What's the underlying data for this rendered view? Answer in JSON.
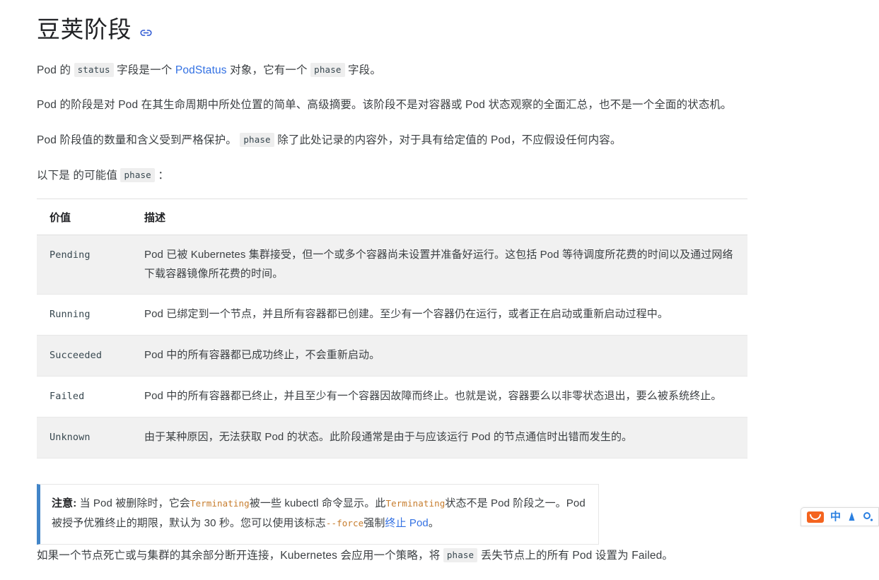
{
  "heading": {
    "title": "豆荚阶段",
    "anchor_icon": "link-icon"
  },
  "paragraphs": {
    "p1_a": "Pod 的 ",
    "p1_code1": "status",
    "p1_b": " 字段是一个 ",
    "p1_link": "PodStatus",
    "p1_c": " 对象，它有一个 ",
    "p1_code2": "phase",
    "p1_d": " 字段。",
    "p2": "Pod 的阶段是对 Pod 在其生命周期中所处位置的简单、高级摘要。该阶段不是对容器或 Pod 状态观察的全面汇总，也不是一个全面的状态机。",
    "p3_a": "Pod 阶段值的数量和含义受到严格保护。 ",
    "p3_code": "phase",
    "p3_b": " 除了此处记录的内容外，对于具有给定值的 Pod，不应假设任何内容。",
    "p4_a": "以下是 的可能值 ",
    "p4_code": "phase",
    "p4_b": " ："
  },
  "table": {
    "headers": [
      "价值",
      "描述"
    ],
    "rows": [
      {
        "value": "Pending",
        "description": "Pod 已被 Kubernetes 集群接受，但一个或多个容器尚未设置并准备好运行。这包括 Pod 等待调度所花费的时间以及通过网络下载容器镜像所花费的时间。"
      },
      {
        "value": "Running",
        "description": "Pod 已绑定到一个节点，并且所有容器都已创建。至少有一个容器仍在运行，或者正在启动或重新启动过程中。"
      },
      {
        "value": "Succeeded",
        "description": "Pod 中的所有容器都已成功终止，不会重新启动。"
      },
      {
        "value": "Failed",
        "description": "Pod 中的所有容器都已终止，并且至少有一个容器因故障而终止。也就是说，容器要么以非零状态退出，要么被系统终止。"
      },
      {
        "value": "Unknown",
        "description": "由于某种原因，无法获取 Pod 的状态。此阶段通常是由于与应该运行 Pod 的节点通信时出错而发生的。"
      }
    ]
  },
  "note": {
    "label": "注意:",
    "a": " 当 Pod 被删除时，它会",
    "code1": "Terminating",
    "b": "被一些 kubectl 命令显示。此",
    "code2": "Terminating",
    "c": "状态不是 Pod 阶段之一。Pod 被授予优雅终止的期限，默认为 30 秒。您可以使用该标志",
    "code3": "--force",
    "d": "强制",
    "link": "终止 Pod",
    "e": "。"
  },
  "closing": {
    "a": "如果一个节点死亡或与集群的其余部分断开连接，Kubernetes 会应用一个策略，将 ",
    "code": "phase",
    "b": " 丢失节点上的所有 Pod 设置为 Failed。"
  },
  "ime_bar": {
    "logo": "sogou-logo-icon",
    "mode": "中",
    "shape": "pen-icon",
    "menu": "toolbox-icon"
  },
  "colors": {
    "link": "#3371e3",
    "code_orange": "#c77d2e",
    "note_border": "#4285c8",
    "stripe": "#f1f1f1",
    "ime_orange": "#f4641f",
    "ime_blue": "#2a7fe0"
  }
}
